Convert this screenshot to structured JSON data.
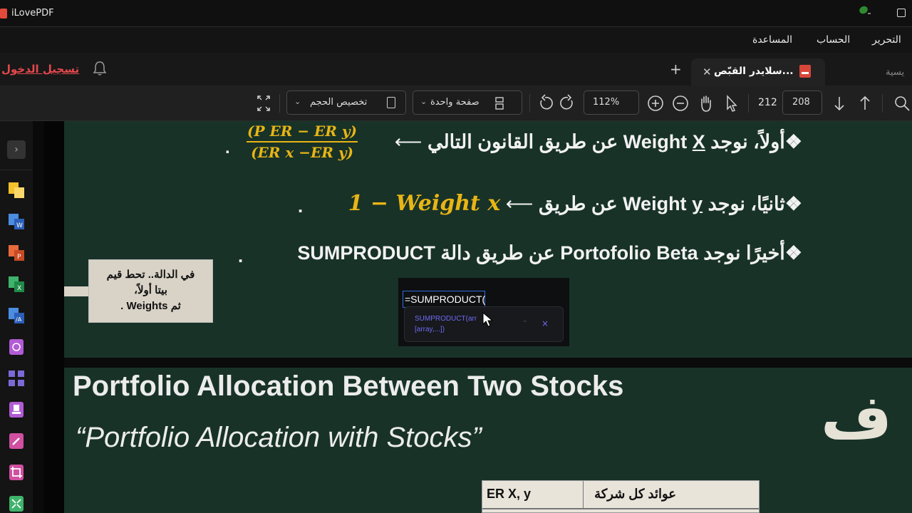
{
  "app": {
    "title": "iLovePDF"
  },
  "menu": {
    "edit": "التحرير",
    "account": "الحساب",
    "help": "المساعدة"
  },
  "tabs": {
    "login": "تسجيل الدخول",
    "active_title": "...سلايدر القبّص",
    "other_partial": "يسية"
  },
  "toolbar": {
    "page_input": "208",
    "page_total": "212",
    "zoom": "112%",
    "view_mode": "صفحة واحدة",
    "fit_mode": "تخصيص الحجم"
  },
  "slide1": {
    "line1_text": "أولاً، نوجد",
    "line1_weight": "Weight ",
    "line1_x": "X",
    "line1_rest": " عن طريق القانون التالي",
    "arrow": "⟵",
    "frac_num": "(P ER − ER y)",
    "frac_den": "(ER x −ER y)",
    "dot": ".",
    "line2_text": "ثانيًا، نوجد",
    "line2_weight": "Weight ",
    "line2_y": "y",
    "line2_rest": " عن طريق",
    "line2_math": "1 − Weight x",
    "line3_text": "أخيرًا نوجد",
    "line3_mid": " Portofolio Beta ",
    "line3_rest": "عن طريق دالة",
    "line3_fn": " SUMPRODUCT",
    "bullet": "❖",
    "callout_l1": "في الدالة.. تحط قيم",
    "callout_l2": "بيتا أولاً،",
    "callout_l3": "ثم Weights .",
    "formula": "=SUMPRODUCT(",
    "tooltip_l1": "SUMPRODUCT(arr",
    "tooltip_l2": "[array,...])",
    "tooltip_close": "×"
  },
  "slide2": {
    "title": "Portfolio Allocation Between Two Stocks",
    "subtitle": "“Portfolio Allocation with Stocks”",
    "letter": "ف",
    "table_col1": "ER X, y",
    "table_col2": "عوائد كل شركة"
  }
}
